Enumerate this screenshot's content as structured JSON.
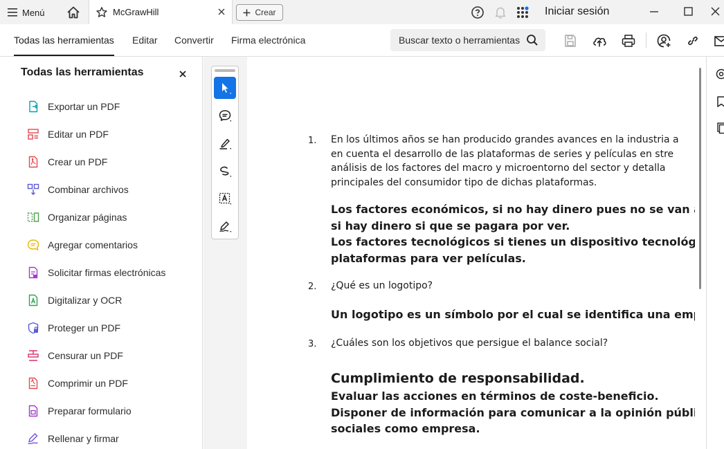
{
  "titlebar": {
    "menu_label": "Menú",
    "tab_title": "McGrawHill",
    "create_label": "Crear",
    "signin_label": "Iniciar sesión"
  },
  "toolbar": {
    "tabs": [
      "Todas las herramientas",
      "Editar",
      "Convertir",
      "Firma electrónica"
    ],
    "search_placeholder": "Buscar texto o herramientas"
  },
  "sidebar": {
    "title": "Todas las herramientas",
    "items": [
      {
        "label": "Exportar un PDF",
        "icon": "export-pdf-icon",
        "color": "#00a2b2"
      },
      {
        "label": "Editar un PDF",
        "icon": "edit-pdf-icon",
        "color": "#e34850"
      },
      {
        "label": "Crear un PDF",
        "icon": "create-pdf-icon",
        "color": "#e34850"
      },
      {
        "label": "Combinar archivos",
        "icon": "combine-files-icon",
        "color": "#5b5bd6"
      },
      {
        "label": "Organizar páginas",
        "icon": "organize-pages-icon",
        "color": "#4ea04b"
      },
      {
        "label": "Agregar comentarios",
        "icon": "comment-icon",
        "color": "#e6b800"
      },
      {
        "label": "Solicitar firmas electrónicas",
        "icon": "request-signature-icon",
        "color": "#a33bc8"
      },
      {
        "label": "Digitalizar y OCR",
        "icon": "scan-ocr-icon",
        "color": "#2da44e"
      },
      {
        "label": "Proteger un PDF",
        "icon": "protect-pdf-icon",
        "color": "#5b5bd6"
      },
      {
        "label": "Censurar un PDF",
        "icon": "redact-pdf-icon",
        "color": "#d6306f"
      },
      {
        "label": "Comprimir un PDF",
        "icon": "compress-pdf-icon",
        "color": "#e34850"
      },
      {
        "label": "Preparar formulario",
        "icon": "prepare-form-icon",
        "color": "#a33bc8"
      },
      {
        "label": "Rellenar y firmar",
        "icon": "fill-sign-icon",
        "color": "#6e4fd8"
      }
    ]
  },
  "document": {
    "q1_num": "1.",
    "q1_lines": [
      "En los últimos años se han producido grandes avances en la industria a",
      "en cuenta el desarrollo de las plataformas de series y películas en stre",
      "análisis de los factores del macro y microentorno del sector y detalla",
      "principales del consumidor tipo de dichas plataformas."
    ],
    "a1_lines": [
      "Los factores económicos, si no hay dinero pues no se van a ve",
      "si hay dinero si que se pagara por ver.",
      "Los factores tecnológicos si tienes un dispositivo tecnológico",
      "plataformas para ver películas."
    ],
    "q2_num": "2.",
    "q2_text": "¿Qué es un logotipo?",
    "a2_text": "Un logotipo es un símbolo por el cual se identifica una empre",
    "q3_num": "3.",
    "q3_text": "¿Cuáles son los objetivos que persigue el balance social?",
    "a3_title": "Cumplimiento de responsabilidad.",
    "a3_lines": [
      "Evaluar las acciones en términos de coste-beneficio.",
      "Disponer de información para comunicar a la opinión pública",
      "sociales como empresa."
    ]
  },
  "colors": {
    "accent": "#1473e6",
    "titlebar_bg": "#f2f2f2",
    "canvas_bg": "#f3f3f3"
  }
}
